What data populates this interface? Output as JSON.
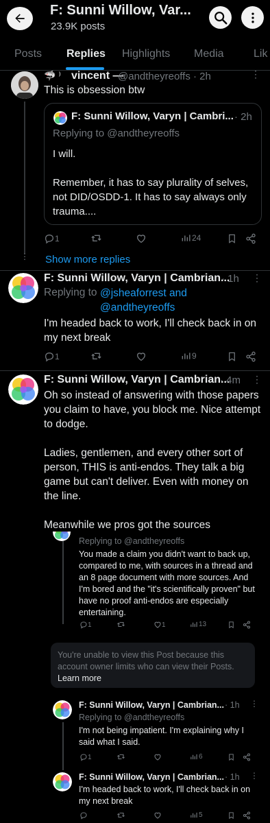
{
  "header": {
    "title": "F: Sunni Willow, Var...",
    "subtitle": "23.9K posts",
    "icons": [
      "back-arrow-icon",
      "search-icon",
      "more-vertical-icon"
    ]
  },
  "tabs": [
    {
      "label": "Posts",
      "active": false
    },
    {
      "label": "Replies",
      "active": true
    },
    {
      "label": "Highlights",
      "active": false
    },
    {
      "label": "Media",
      "active": false
    },
    {
      "label": "Lik",
      "active": false
    }
  ],
  "post1": {
    "name": "vincent —",
    "handle": "@andtheyreoffs · 2h",
    "text": "This is obsession btw",
    "quote": {
      "name": "F: Sunni Willow, Varyn | Cambri...",
      "time": "· 2h",
      "replying": "Replying to @andtheyreoffs",
      "text": "I will.\n\nRemember, it has to say plurality of selves, not DID/OSDD-1. It has to say always only trauma...."
    },
    "replies": "1",
    "views": "24"
  },
  "show_more": "Show more replies",
  "post2": {
    "name": "F: Sunni Willow, Varyn | Cambrian...",
    "time": "· 1h",
    "replying_prefix": "Replying to ",
    "replying_links": "@jsheaforrest and\n@andtheyreoffs",
    "text": "I'm headed back to work, I'll check back in on my next break",
    "replies": "1",
    "views": "9"
  },
  "post3": {
    "name": "F: Sunni Willow, Varyn | Cambrian...",
    "time": "· 4m",
    "text": "Oh so instead of answering with those papers you claim to have, you block me. Nice attempt to dodge.\n\nLadies, gentlemen, and every other sort of person, THIS is anti-endos. They talk a big game but can't deliver. Even with money on the line.\n\nMeanwhile we pros got the sources"
  },
  "embed1": {
    "replying_prefix": "Replying to ",
    "replying_link": "@andtheyreoffs",
    "text": "You made a claim you didn't want to back up, compared to me, with sources in a thread and an 8 page document with more sources. And I'm bored and the \"it's scientifically proven\" but have no proof anti-endos are especially entertaining.",
    "replies": "1",
    "likes": "1",
    "views": "13"
  },
  "notice": {
    "text": "You're unable to view this Post because this account owner limits who can view their Posts.",
    "link": "Learn more"
  },
  "embed2": {
    "name": "F: Sunni Willow, Varyn | Cambrian...",
    "time": "· 1h",
    "replying_prefix": "Replying to ",
    "replying_link": "@andtheyreoffs",
    "text": "I'm not being impatient. I'm explaining why I said what I said.",
    "replies": "1",
    "views": "6"
  },
  "embed3": {
    "name": "F: Sunni Willow, Varyn | Cambrian...",
    "time": "· 1h",
    "text": "I'm headed back to work, I'll check back in on my next break",
    "views": "5"
  },
  "colors": {
    "accent": "#1d9bf0",
    "background": "#000000",
    "muted": "#71767b"
  }
}
